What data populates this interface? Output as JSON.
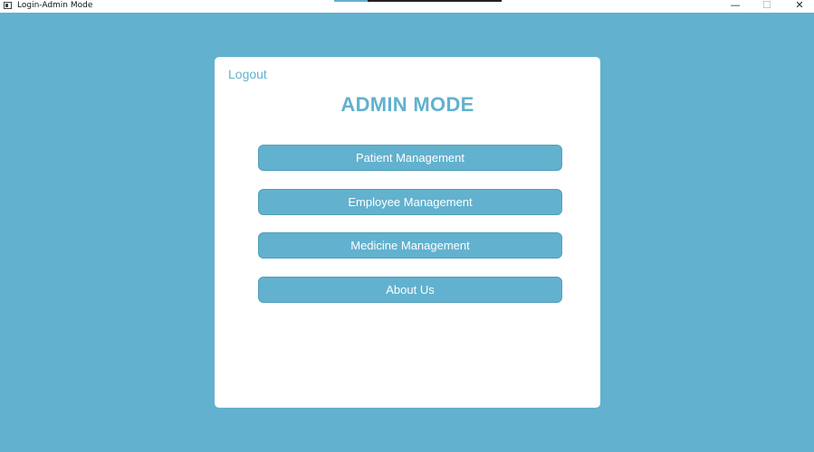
{
  "window": {
    "title": "Login-Admin Mode",
    "minimize_glyph": "—",
    "maximize_glyph": "☐",
    "close_glyph": "✕"
  },
  "card": {
    "logout_label": "Logout",
    "title": "ADMIN MODE",
    "menu": [
      {
        "label": "Patient Management"
      },
      {
        "label": "Employee Management"
      },
      {
        "label": "Medicine Management"
      },
      {
        "label": "About Us"
      }
    ]
  },
  "colors": {
    "background": "#62b1ce",
    "card": "#ffffff",
    "accent": "#62b1ce",
    "button_text": "#ffffff"
  }
}
